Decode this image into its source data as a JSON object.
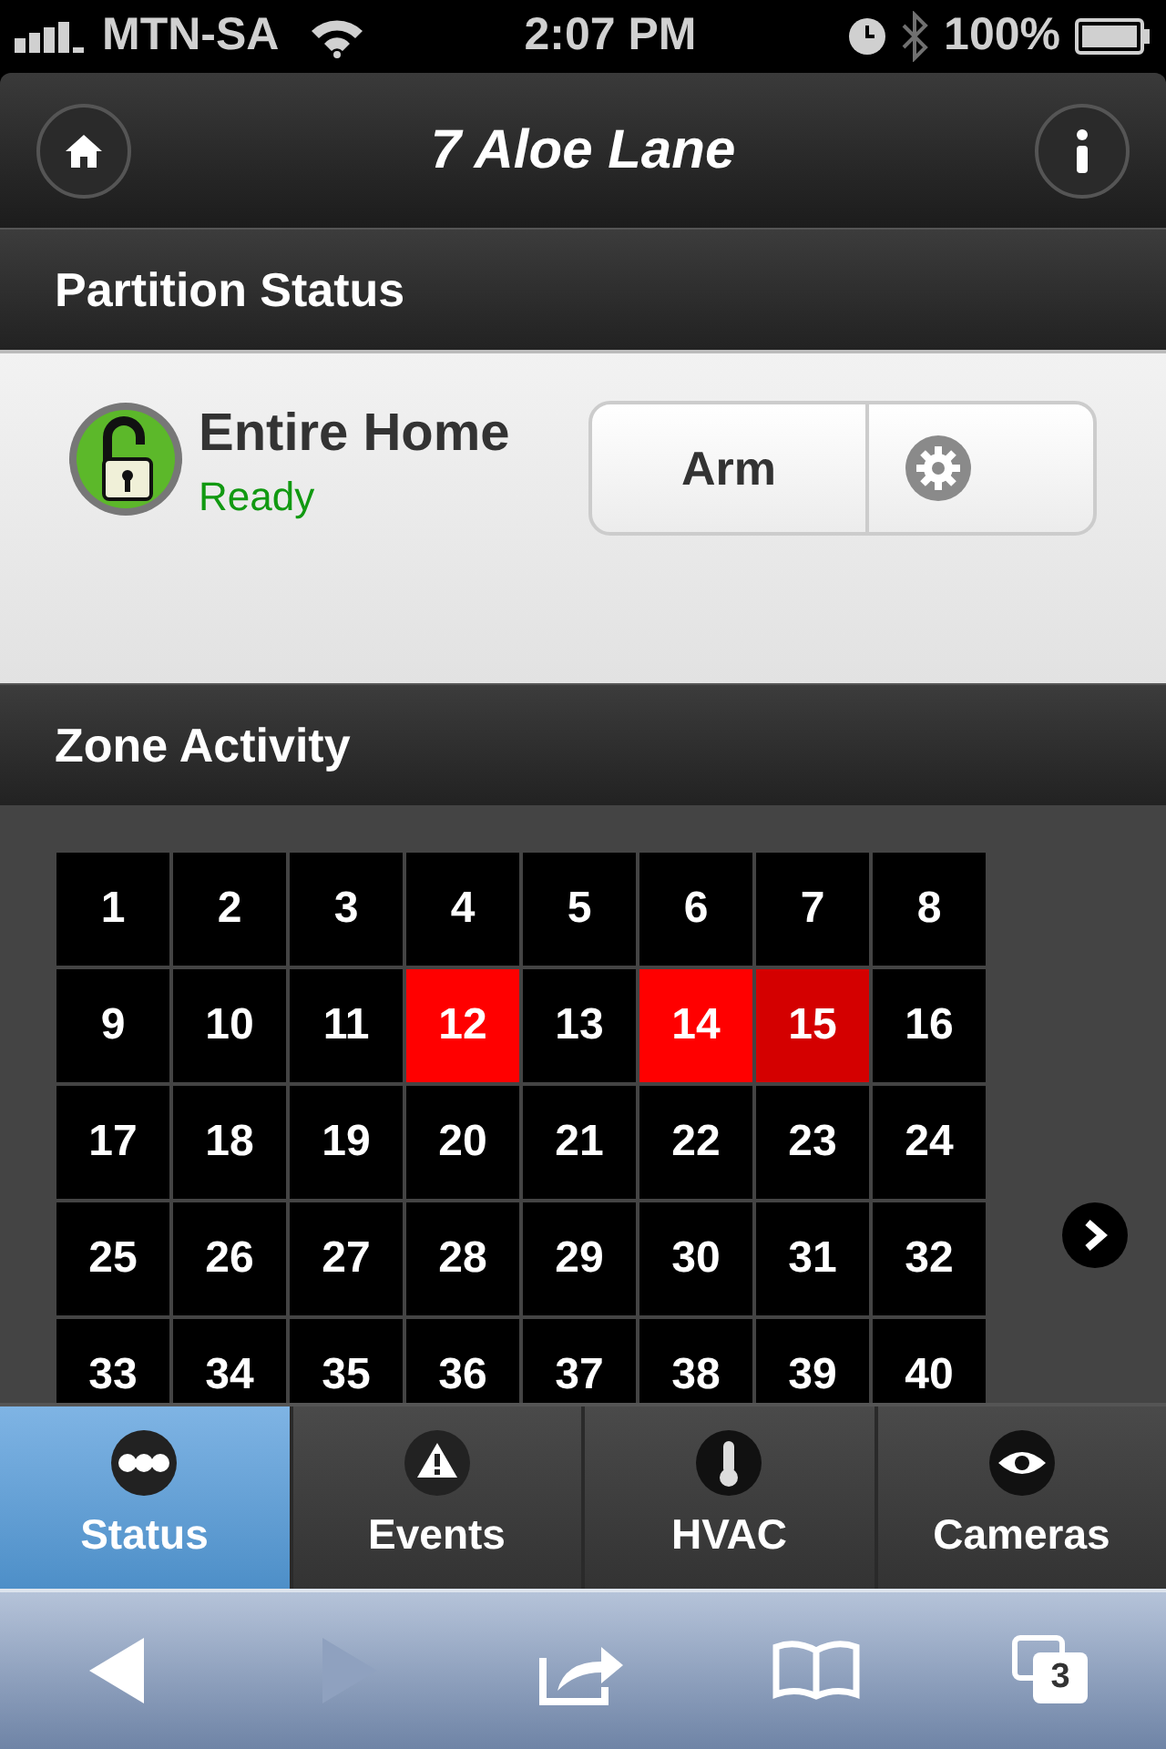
{
  "status_bar": {
    "carrier": "MTN-SA",
    "time": "2:07 PM",
    "battery": "100%"
  },
  "header": {
    "title": "7 Aloe Lane"
  },
  "partition_section": {
    "title": "Partition Status",
    "partition": {
      "name": "Entire Home",
      "status": "Ready"
    },
    "arm_button": "Arm"
  },
  "zone_section": {
    "title": "Zone Activity",
    "zones": [
      {
        "label": "1",
        "color": "#000000"
      },
      {
        "label": "2",
        "color": "#000000"
      },
      {
        "label": "3",
        "color": "#000000"
      },
      {
        "label": "4",
        "color": "#000000"
      },
      {
        "label": "5",
        "color": "#000000"
      },
      {
        "label": "6",
        "color": "#000000"
      },
      {
        "label": "7",
        "color": "#000000"
      },
      {
        "label": "8",
        "color": "#000000"
      },
      {
        "label": "9",
        "color": "#000000"
      },
      {
        "label": "10",
        "color": "#000000"
      },
      {
        "label": "11",
        "color": "#000000"
      },
      {
        "label": "12",
        "color": "#ff0000"
      },
      {
        "label": "13",
        "color": "#000000"
      },
      {
        "label": "14",
        "color": "#ff0000"
      },
      {
        "label": "15",
        "color": "#d40000"
      },
      {
        "label": "16",
        "color": "#000000"
      },
      {
        "label": "17",
        "color": "#000000"
      },
      {
        "label": "18",
        "color": "#000000"
      },
      {
        "label": "19",
        "color": "#000000"
      },
      {
        "label": "20",
        "color": "#000000"
      },
      {
        "label": "21",
        "color": "#000000"
      },
      {
        "label": "22",
        "color": "#000000"
      },
      {
        "label": "23",
        "color": "#000000"
      },
      {
        "label": "24",
        "color": "#000000"
      },
      {
        "label": "25",
        "color": "#000000"
      },
      {
        "label": "26",
        "color": "#000000"
      },
      {
        "label": "27",
        "color": "#000000"
      },
      {
        "label": "28",
        "color": "#000000"
      },
      {
        "label": "29",
        "color": "#000000"
      },
      {
        "label": "30",
        "color": "#000000"
      },
      {
        "label": "31",
        "color": "#000000"
      },
      {
        "label": "32",
        "color": "#000000"
      },
      {
        "label": "33",
        "color": "#000000"
      },
      {
        "label": "34",
        "color": "#000000"
      },
      {
        "label": "35",
        "color": "#000000"
      },
      {
        "label": "36",
        "color": "#000000"
      },
      {
        "label": "37",
        "color": "#000000"
      },
      {
        "label": "38",
        "color": "#000000"
      },
      {
        "label": "39",
        "color": "#000000"
      },
      {
        "label": "40",
        "color": "#000000"
      }
    ]
  },
  "tabs": [
    {
      "label": "Status",
      "kind": "status",
      "selected": true
    },
    {
      "label": "Events",
      "kind": "events",
      "selected": false
    },
    {
      "label": "HVAC",
      "kind": "hvac",
      "selected": false
    },
    {
      "label": "Cameras",
      "kind": "cameras",
      "selected": false
    }
  ],
  "browser_toolbar": {
    "back_disabled": false,
    "forward_disabled": true,
    "tab_count": "3"
  }
}
